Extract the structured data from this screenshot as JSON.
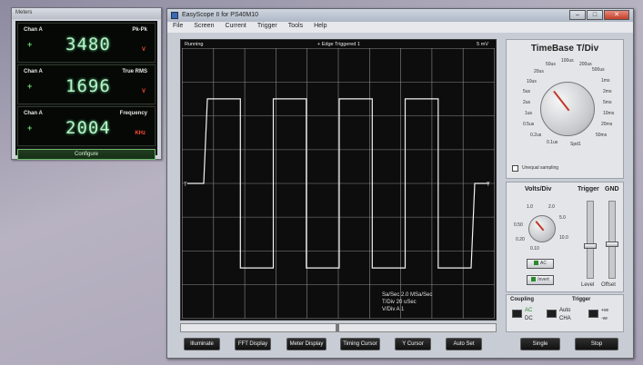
{
  "meters_window": {
    "title": "Meters",
    "meters": [
      {
        "channel": "Chan A",
        "measurement": "Pk-Pk",
        "value": "3480",
        "unit": "V",
        "sign": "+"
      },
      {
        "channel": "Chan A",
        "measurement": "True RMS",
        "value": "1696",
        "unit": "V",
        "sign": "+"
      },
      {
        "channel": "Chan A",
        "measurement": "Frequency",
        "value": "2004",
        "unit": "KHz",
        "sign": "+"
      }
    ],
    "configure_label": "Configure"
  },
  "main_window": {
    "title": "EasyScope II for PS40M10",
    "menu": [
      "File",
      "Screen",
      "Current",
      "Trigger",
      "Tools",
      "Help"
    ],
    "window_buttons": {
      "minimize": "–",
      "maximize": "□",
      "close": "✕"
    }
  },
  "screen": {
    "status_left": "Running",
    "status_center": "+ Edge Triggered  1",
    "status_right": "5 mV",
    "trigger_marker_left": "T",
    "trigger_marker_right": "T",
    "info_lines": [
      "Sa/Sec   2.0 MSa/Sec",
      "T/Div    20 uSec",
      "V/Div   A 1"
    ],
    "waveform": {
      "type": "square",
      "cycles_visible": 4,
      "duty_cycle": 0.5,
      "high_level_div": 2.5,
      "low_level_div": -2.5
    }
  },
  "timebase": {
    "title": "TimeBase T/Div",
    "labels": [
      "50us",
      "100us",
      "200us",
      "500us",
      "20us",
      "10us",
      "5us",
      "2us",
      "1us",
      "0.5us",
      "0.2us",
      "0.1us",
      "1ms",
      "2ms",
      "5ms",
      "10ms",
      "20ms",
      "50ms",
      "Spd1"
    ],
    "selected": "20us",
    "unequal_sampling_label": "Unequal sampling"
  },
  "volts": {
    "title": "Volts/Div",
    "trigger_label": "Trigger",
    "gnd_label": "GND",
    "labels": [
      "1.0",
      "2.0",
      "0.50",
      "5.0",
      "0.20",
      "10.0",
      "0.10"
    ],
    "ac_button": "AC",
    "dc_button": "Invert",
    "level_label": "Level",
    "offset_label": "Offset"
  },
  "coupling": {
    "coupling_heading": "Coupling",
    "trigger_heading": "Trigger",
    "ac": "AC",
    "dc": "DC",
    "auto": "Auto",
    "cha": "CHA",
    "pos": "+ve",
    "neg": "-ve"
  },
  "buttons": [
    "Illuminate",
    "FFT Display",
    "Meter Display",
    "Timing Cursor",
    "Y Cursor",
    "Auto Set",
    "Single",
    "Stop"
  ],
  "colors": {
    "trace": "#f2f2f2",
    "grid": "#8a8a8a",
    "meter_digits": "#b9f2c9",
    "meter_unit": "#ff4a3a"
  }
}
